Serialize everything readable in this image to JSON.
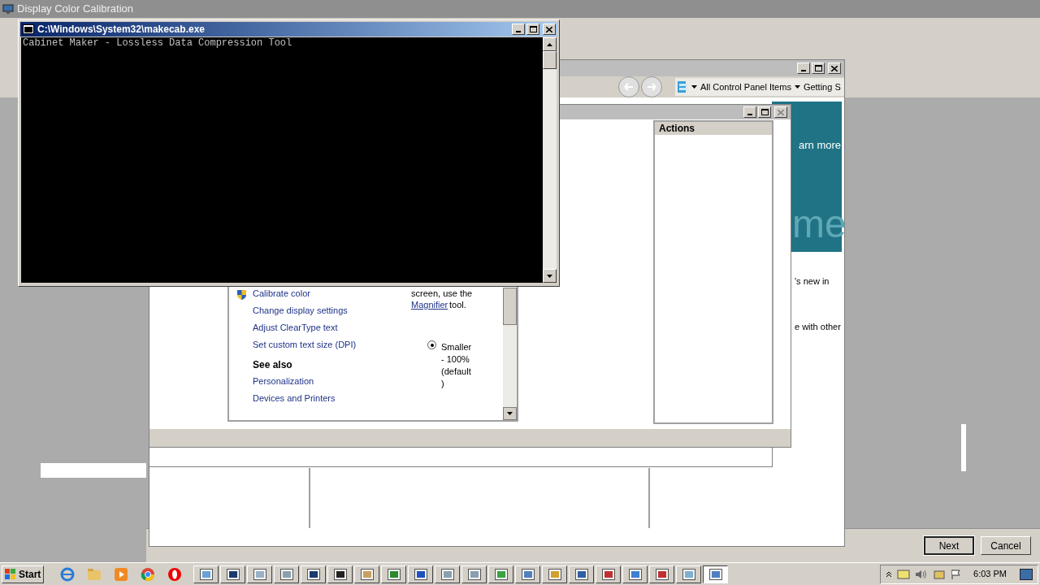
{
  "background_window": {
    "title": "Display Color Calibration"
  },
  "console": {
    "title": "C:\\Windows\\System32\\makecab.exe",
    "output": "Cabinet Maker - Lossless Data Compression Tool"
  },
  "control_panel": {
    "breadcrumbs": [
      "All Control Panel Items",
      "Getting S"
    ],
    "banner_texts": [
      "arn more"
    ],
    "banner_heading": "me",
    "body_texts": [
      "'s new in",
      "e with other"
    ]
  },
  "actions_window": {
    "pane_title": "Actions"
  },
  "display_window": {
    "tasks": [
      {
        "label": "Calibrate color",
        "shield": true
      },
      {
        "label": "Change display settings",
        "shield": false
      },
      {
        "label": "Adjust ClearType text",
        "shield": false
      },
      {
        "label": "Set custom text size (DPI)",
        "shield": false
      }
    ],
    "see_also_heading": "See also",
    "see_also": [
      "Personalization",
      "Devices and Printers"
    ],
    "hint": {
      "before": "screen, use the",
      "link": "Magnifier",
      "after": "tool."
    },
    "radio": {
      "lines": [
        "Smaller",
        "- 100%",
        "(default",
        ")"
      ],
      "selected": true
    }
  },
  "wizard_buttons": [
    {
      "label": "Next",
      "default": true
    },
    {
      "label": "Cancel",
      "default": false
    }
  ],
  "taskbar": {
    "start": "Start",
    "tasks": [
      {
        "selected": false
      },
      {
        "selected": false
      },
      {
        "selected": false
      },
      {
        "selected": false
      },
      {
        "selected": false
      },
      {
        "selected": false
      },
      {
        "selected": false
      },
      {
        "selected": false
      },
      {
        "selected": false
      },
      {
        "selected": false
      },
      {
        "selected": false
      },
      {
        "selected": false
      },
      {
        "selected": false
      },
      {
        "selected": false
      },
      {
        "selected": false
      },
      {
        "selected": false
      },
      {
        "selected": false
      },
      {
        "selected": false
      },
      {
        "selected": false
      },
      {
        "selected": true
      }
    ],
    "clock": "6:03 PM"
  }
}
